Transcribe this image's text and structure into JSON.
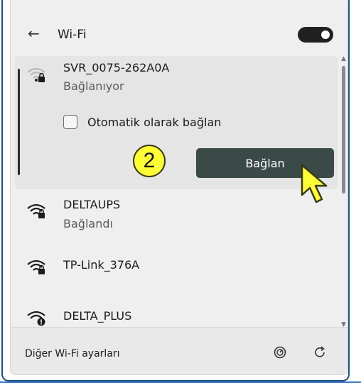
{
  "header": {
    "title": "Wi-Fi",
    "back_icon": "←"
  },
  "networks": [
    {
      "ssid": "SVR_0075-262A0A",
      "status": "Bağlanıyor",
      "icon": "wifi-secured-weak-icon",
      "expanded": true
    },
    {
      "ssid": "DELTAUPS",
      "status": "Bağlandı",
      "icon": "wifi-secured-icon"
    },
    {
      "ssid": "TP-Link_376A",
      "status": "",
      "icon": "wifi-secured-icon"
    },
    {
      "ssid": "DELTA_PLUS",
      "status": "",
      "icon": "wifi-warning-icon"
    }
  ],
  "expanded": {
    "auto_connect_label": "Otomatik olarak bağlan",
    "connect_label": "Bağlan",
    "auto_connect_checked": false
  },
  "annotation": {
    "step_number": "2"
  },
  "footer": {
    "more_settings": "Diğer Wi-Fi ayarları"
  },
  "colors": {
    "accent_button": "#3a4a47",
    "step_badge": "#ffff33",
    "toggle_on": "#202020"
  }
}
